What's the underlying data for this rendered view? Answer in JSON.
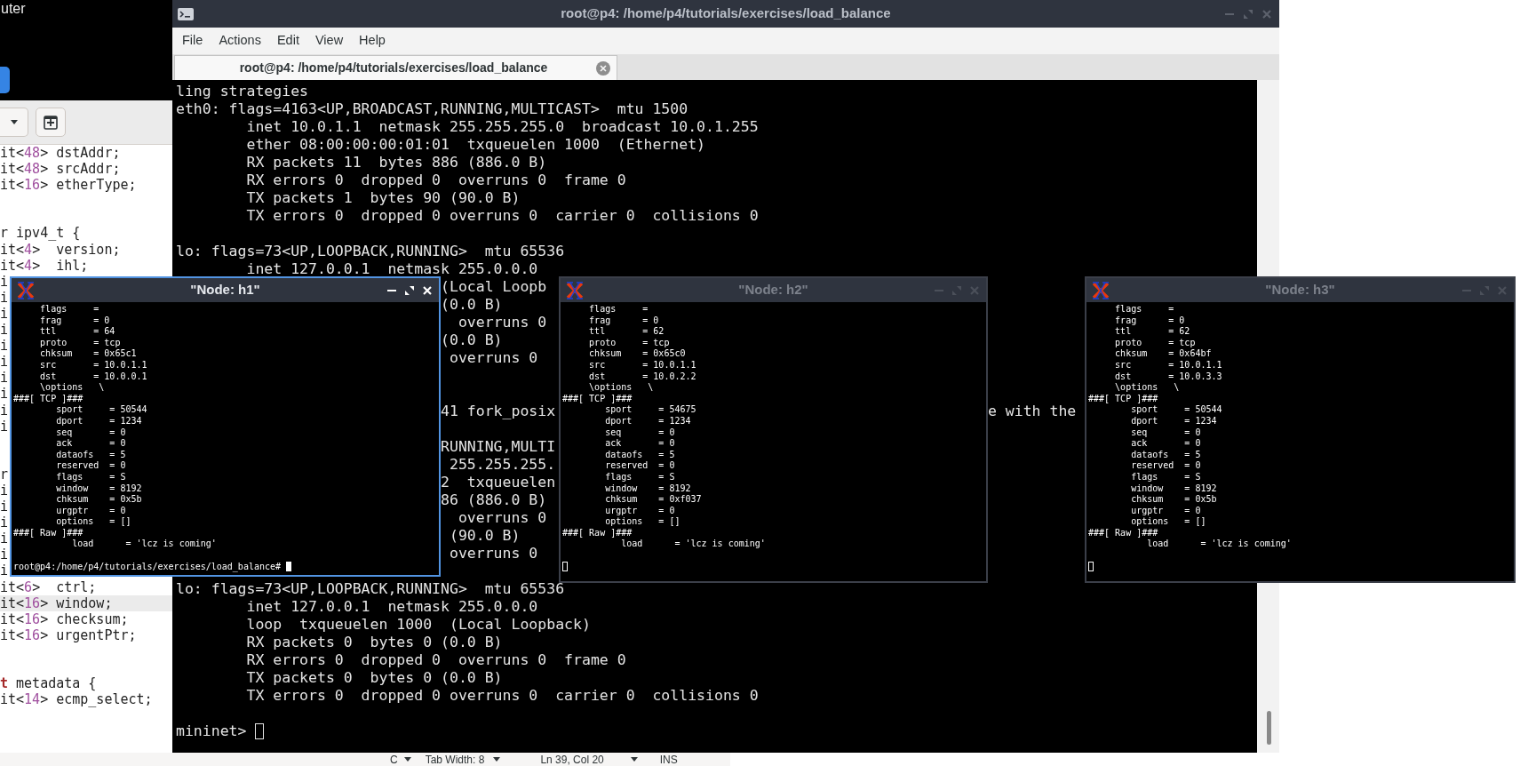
{
  "desktop_label": "uter",
  "editor": {
    "lines": [
      {
        "current": false,
        "segments": [
          {
            "text": "it<"
          },
          {
            "kind": "number",
            "text": "48"
          },
          {
            "text": "> dstAddr;"
          }
        ]
      },
      {
        "current": false,
        "segments": [
          {
            "text": "it<"
          },
          {
            "kind": "number",
            "text": "48"
          },
          {
            "text": "> srcAddr;"
          }
        ]
      },
      {
        "current": false,
        "segments": [
          {
            "text": "it<"
          },
          {
            "kind": "number",
            "text": "16"
          },
          {
            "text": "> etherType;"
          }
        ]
      },
      {
        "current": false
      },
      {
        "current": false
      },
      {
        "current": false,
        "segments": [
          {
            "text": "r ipv4_t {"
          }
        ]
      },
      {
        "current": false,
        "segments": [
          {
            "text": "it<"
          },
          {
            "kind": "number",
            "text": "4"
          },
          {
            "text": ">  version;"
          }
        ]
      },
      {
        "current": false,
        "segments": [
          {
            "text": "it<"
          },
          {
            "kind": "number",
            "text": "4"
          },
          {
            "text": ">  ihl;"
          }
        ]
      },
      {
        "current": false,
        "segments": [
          {
            "text": "i"
          }
        ]
      },
      {
        "current": false,
        "segments": [
          {
            "text": "i"
          }
        ]
      },
      {
        "current": false,
        "segments": [
          {
            "text": "i"
          }
        ]
      },
      {
        "current": false,
        "segments": [
          {
            "text": "i"
          }
        ]
      },
      {
        "current": false,
        "segments": [
          {
            "text": "i"
          }
        ]
      },
      {
        "current": false,
        "segments": [
          {
            "text": "i"
          }
        ]
      },
      {
        "current": false,
        "segments": [
          {
            "text": "i"
          }
        ]
      },
      {
        "current": false,
        "segments": [
          {
            "text": "i"
          }
        ]
      },
      {
        "current": false,
        "segments": [
          {
            "text": "i"
          }
        ]
      },
      {
        "current": false,
        "segments": [
          {
            "text": "i"
          }
        ]
      },
      {
        "current": false
      },
      {
        "current": false
      },
      {
        "current": false,
        "segments": [
          {
            "text": "r"
          }
        ]
      },
      {
        "current": false,
        "segments": [
          {
            "text": "i"
          }
        ]
      },
      {
        "current": false,
        "segments": [
          {
            "text": "i"
          }
        ]
      },
      {
        "current": false,
        "segments": [
          {
            "text": "i"
          }
        ]
      },
      {
        "current": false,
        "segments": [
          {
            "text": "i"
          }
        ]
      },
      {
        "current": false,
        "segments": [
          {
            "text": "i"
          }
        ]
      },
      {
        "current": false,
        "segments": [
          {
            "text": "i"
          }
        ]
      },
      {
        "current": false,
        "segments": [
          {
            "text": "it<"
          },
          {
            "kind": "number",
            "text": "6"
          },
          {
            "text": ">  ctrl;"
          }
        ]
      },
      {
        "current": true,
        "segments": [
          {
            "text": "it<"
          },
          {
            "kind": "number",
            "text": "16"
          },
          {
            "text": "> window;"
          }
        ]
      },
      {
        "current": false,
        "segments": [
          {
            "text": "it<"
          },
          {
            "kind": "number",
            "text": "16"
          },
          {
            "text": "> checksum;"
          }
        ]
      },
      {
        "current": false,
        "segments": [
          {
            "text": "it<"
          },
          {
            "kind": "number",
            "text": "16"
          },
          {
            "text": "> urgentPtr;"
          }
        ]
      },
      {
        "current": false
      },
      {
        "current": false
      },
      {
        "current": false,
        "segments": [
          {
            "kind": "keyword",
            "text": "t"
          },
          {
            "text": " metadata {"
          }
        ]
      },
      {
        "current": false,
        "segments": [
          {
            "text": "it<"
          },
          {
            "kind": "number",
            "text": "14"
          },
          {
            "text": "> ecmp_select;"
          }
        ]
      }
    ],
    "status_bar": {
      "language": "C",
      "tab_width": "Tab Width: 8",
      "position": "Ln 39, Col 20",
      "mode": "INS"
    }
  },
  "terminal": {
    "title": "root@p4: /home/p4/tutorials/exercises/load_balance",
    "menu": [
      "File",
      "Actions",
      "Edit",
      "View",
      "Help"
    ],
    "tab": {
      "label": "root@p4: /home/p4/tutorials/exercises/load_balance",
      "selected": true
    },
    "lines": [
      {
        "kind": "text",
        "text": "ling strategies"
      },
      {
        "kind": "text",
        "text": "eth0: flags=4163<UP,BROADCAST,RUNNING,MULTICAST>  mtu 1500"
      },
      {
        "kind": "text",
        "text": "        inet 10.0.1.1  netmask 255.255.255.0  broadcast 10.0.1.255"
      },
      {
        "kind": "text",
        "text": "        ether 08:00:00:00:01:01  txqueuelen 1000  (Ethernet)"
      },
      {
        "kind": "text",
        "text": "        RX packets 11  bytes 886 (886.0 B)"
      },
      {
        "kind": "text",
        "text": "        RX errors 0  dropped 0  overruns 0  frame 0"
      },
      {
        "kind": "text",
        "text": "        TX packets 1  bytes 90 (90.0 B)"
      },
      {
        "kind": "text",
        "text": "        TX errors 0  dropped 0 overruns 0  carrier 0  collisions 0"
      },
      {
        "kind": "blank"
      },
      {
        "kind": "text",
        "text": "lo: flags=73<UP,LOOPBACK,RUNNING>  mtu 65536"
      },
      {
        "kind": "text",
        "text": "        inet 127.0.0.1  netmask 255.0.0.0"
      },
      {
        "kind": "text",
        "text": "                              (Local Loopb"
      },
      {
        "kind": "text",
        "text": "                              (0.0 B)"
      },
      {
        "kind": "text",
        "text": "                                overruns 0"
      },
      {
        "kind": "text",
        "text": "                              (0.0 B)"
      },
      {
        "kind": "text",
        "text": "                               overruns 0"
      },
      {
        "kind": "blank"
      },
      {
        "kind": "blank"
      },
      {
        "kind": "text",
        "text": "                              41 fork_posix                                                 e with the"
      },
      {
        "kind": "blank"
      },
      {
        "kind": "text",
        "text": "                              RUNNING,MULTI"
      },
      {
        "kind": "text",
        "text": "                               255.255.255."
      },
      {
        "kind": "text",
        "text": "                              2  txqueuelen"
      },
      {
        "kind": "text",
        "text": "                              86 (886.0 B)"
      },
      {
        "kind": "text",
        "text": "                                overruns 0"
      },
      {
        "kind": "text",
        "text": "                               (90.0 B)"
      },
      {
        "kind": "text",
        "text": "                               overruns 0"
      },
      {
        "kind": "blank"
      },
      {
        "kind": "text",
        "text": "lo: flags=73<UP,LOOPBACK,RUNNING>  mtu 65536"
      },
      {
        "kind": "text",
        "text": "        inet 127.0.0.1  netmask 255.0.0.0"
      },
      {
        "kind": "text",
        "text": "        loop  txqueuelen 1000  (Local Loopback)"
      },
      {
        "kind": "text",
        "text": "        RX packets 0  bytes 0 (0.0 B)"
      },
      {
        "kind": "text",
        "text": "        RX errors 0  dropped 0  overruns 0  frame 0"
      },
      {
        "kind": "text",
        "text": "        TX packets 0  bytes 0 (0.0 B)"
      },
      {
        "kind": "text",
        "text": "        TX errors 0  dropped 0 overruns 0  carrier 0  collisions 0"
      },
      {
        "kind": "blank"
      }
    ],
    "prompt": "mininet>"
  },
  "nodes": [
    {
      "title": "\"Node: h1\"",
      "focused": true,
      "lines": [
        {
          "kind": "text",
          "text": "     flags     ="
        },
        {
          "kind": "text",
          "text": "     frag      = 0"
        },
        {
          "kind": "text",
          "text": "     ttl       = 64"
        },
        {
          "kind": "text",
          "text": "     proto     = tcp"
        },
        {
          "kind": "text",
          "text": "     chksum    = 0x65c1"
        },
        {
          "kind": "text",
          "text": "     src       = 10.0.1.1"
        },
        {
          "kind": "text",
          "text": "     dst       = 10.0.0.1"
        },
        {
          "kind": "text",
          "text": "     \\options   \\"
        },
        {
          "kind": "text",
          "text": "###[ TCP ]###"
        },
        {
          "kind": "text",
          "text": "        sport     = 50544"
        },
        {
          "kind": "text",
          "text": "        dport     = 1234"
        },
        {
          "kind": "text",
          "text": "        seq       = 0"
        },
        {
          "kind": "text",
          "text": "        ack       = 0"
        },
        {
          "kind": "text",
          "text": "        dataofs   = 5"
        },
        {
          "kind": "text",
          "text": "        reserved  = 0"
        },
        {
          "kind": "text",
          "text": "        flags     = S"
        },
        {
          "kind": "text",
          "text": "        window    = 8192"
        },
        {
          "kind": "text",
          "text": "        chksum    = 0x5b"
        },
        {
          "kind": "text",
          "text": "        urgptr    = 0"
        },
        {
          "kind": "text",
          "text": "        options   = []"
        },
        {
          "kind": "text",
          "text": "###[ Raw ]###"
        },
        {
          "kind": "text",
          "text": "           load      = 'lcz is coming'"
        },
        {
          "kind": "blank"
        }
      ],
      "prompt": "root@p4:/home/p4/tutorials/exercises/load_balance#"
    },
    {
      "title": "\"Node: h2\"",
      "focused": false,
      "lines": [
        {
          "kind": "text",
          "text": "     flags     ="
        },
        {
          "kind": "text",
          "text": "     frag      = 0"
        },
        {
          "kind": "text",
          "text": "     ttl       = 62"
        },
        {
          "kind": "text",
          "text": "     proto     = tcp"
        },
        {
          "kind": "text",
          "text": "     chksum    = 0x65c0"
        },
        {
          "kind": "text",
          "text": "     src       = 10.0.1.1"
        },
        {
          "kind": "text",
          "text": "     dst       = 10.0.2.2"
        },
        {
          "kind": "text",
          "text": "     \\options   \\"
        },
        {
          "kind": "text",
          "text": "###[ TCP ]###"
        },
        {
          "kind": "text",
          "text": "        sport     = 54675"
        },
        {
          "kind": "text",
          "text": "        dport     = 1234"
        },
        {
          "kind": "text",
          "text": "        seq       = 0"
        },
        {
          "kind": "text",
          "text": "        ack       = 0"
        },
        {
          "kind": "text",
          "text": "        dataofs   = 5"
        },
        {
          "kind": "text",
          "text": "        reserved  = 0"
        },
        {
          "kind": "text",
          "text": "        flags     = S"
        },
        {
          "kind": "text",
          "text": "        window    = 8192"
        },
        {
          "kind": "text",
          "text": "        chksum    = 0xf037"
        },
        {
          "kind": "text",
          "text": "        urgptr    = 0"
        },
        {
          "kind": "text",
          "text": "        options   = []"
        },
        {
          "kind": "text",
          "text": "###[ Raw ]###"
        },
        {
          "kind": "text",
          "text": "           load      = 'lcz is coming'"
        },
        {
          "kind": "blank"
        }
      ]
    },
    {
      "title": "\"Node: h3\"",
      "focused": false,
      "lines": [
        {
          "kind": "text",
          "text": "     flags     ="
        },
        {
          "kind": "text",
          "text": "     frag      = 0"
        },
        {
          "kind": "text",
          "text": "     ttl       = 62"
        },
        {
          "kind": "text",
          "text": "     proto     = tcp"
        },
        {
          "kind": "text",
          "text": "     chksum    = 0x64bf"
        },
        {
          "kind": "text",
          "text": "     src       = 10.0.1.1"
        },
        {
          "kind": "text",
          "text": "     dst       = 10.0.3.3"
        },
        {
          "kind": "text",
          "text": "     \\options   \\"
        },
        {
          "kind": "text",
          "text": "###[ TCP ]###"
        },
        {
          "kind": "text",
          "text": "        sport     = 50544"
        },
        {
          "kind": "text",
          "text": "        dport     = 1234"
        },
        {
          "kind": "text",
          "text": "        seq       = 0"
        },
        {
          "kind": "text",
          "text": "        ack       = 0"
        },
        {
          "kind": "text",
          "text": "        dataofs   = 5"
        },
        {
          "kind": "text",
          "text": "        reserved  = 0"
        },
        {
          "kind": "text",
          "text": "        flags     = S"
        },
        {
          "kind": "text",
          "text": "        window    = 8192"
        },
        {
          "kind": "text",
          "text": "        chksum    = 0x5b"
        },
        {
          "kind": "text",
          "text": "        urgptr    = 0"
        },
        {
          "kind": "text",
          "text": "        options   = []"
        },
        {
          "kind": "text",
          "text": "###[ Raw ]###"
        },
        {
          "kind": "text",
          "text": "           load      = 'lcz is coming'"
        },
        {
          "kind": "blank"
        }
      ]
    }
  ]
}
